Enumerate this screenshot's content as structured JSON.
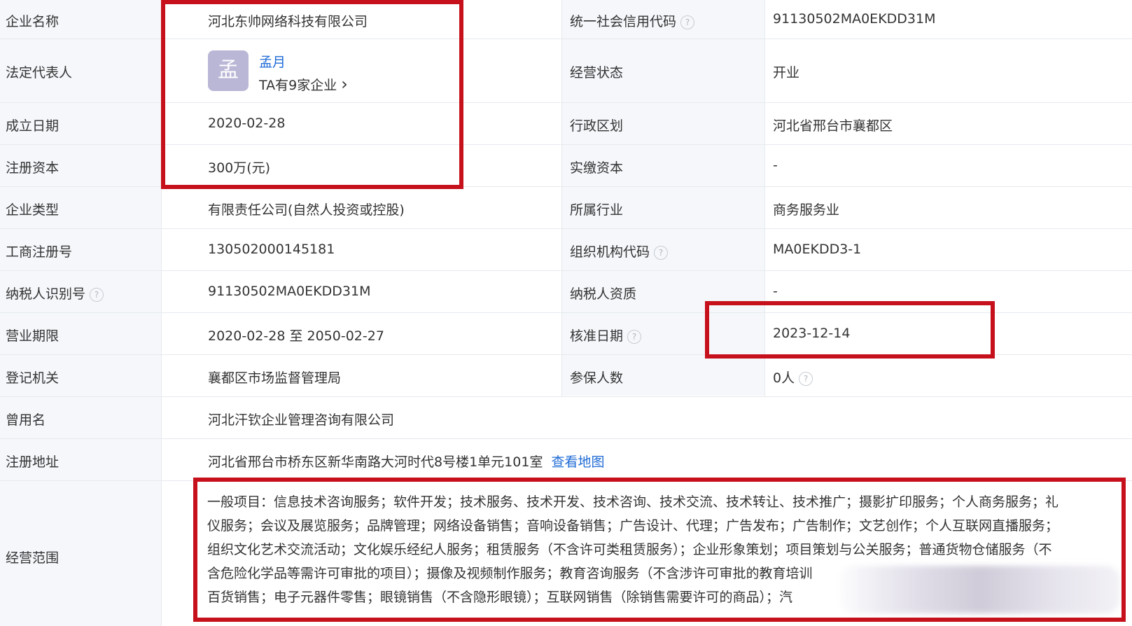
{
  "rows": {
    "company_name": {
      "label": "企业名称",
      "value": "河北东帅网络科技有限公司"
    },
    "credit_code": {
      "label": "统一社会信用代码",
      "value": "91130502MA0EKDD31M"
    },
    "legal_rep": {
      "label": "法定代表人",
      "name": "孟月",
      "avatar_char": "孟",
      "company_count": "TA有9家企业"
    },
    "business_status": {
      "label": "经营状态",
      "value": "开业"
    },
    "founded": {
      "label": "成立日期",
      "value": "2020-02-28"
    },
    "admin_region": {
      "label": "行政区划",
      "value": "河北省邢台市襄都区"
    },
    "reg_capital": {
      "label": "注册资本",
      "value": "300万(元)"
    },
    "paid_capital": {
      "label": "实缴资本",
      "value": "-"
    },
    "company_type": {
      "label": "企业类型",
      "value": "有限责任公司(自然人投资或控股)"
    },
    "industry": {
      "label": "所属行业",
      "value": "商务服务业"
    },
    "biz_reg_no": {
      "label": "工商注册号",
      "value": "130502000145181"
    },
    "org_code": {
      "label": "组织机构代码",
      "value": "MA0EKDD3-1"
    },
    "taxpayer_id": {
      "label": "纳税人识别号",
      "value": "91130502MA0EKDD31M"
    },
    "taxpayer_qual": {
      "label": "纳税人资质",
      "value": "-"
    },
    "biz_term": {
      "label": "营业期限",
      "value": "2020-02-28 至 2050-02-27"
    },
    "approval_date": {
      "label": "核准日期",
      "value": "2023-12-14"
    },
    "reg_authority": {
      "label": "登记机关",
      "value": "襄都区市场监督管理局"
    },
    "insured": {
      "label": "参保人数",
      "value": "0人"
    },
    "former_name": {
      "label": "曾用名",
      "value": "河北汗钦企业管理咨询有限公司"
    },
    "reg_address": {
      "label": "注册地址",
      "value": "河北省邢台市桥东区新华南路大河时代8号楼1单元101室",
      "map_link": "查看地图"
    },
    "biz_scope": {
      "label": "经营范围",
      "lines": [
        "一般项目：信息技术咨询服务；软件开发；技术服务、技术开发、技术咨询、技术交流、技术转让、技术推广；摄影扩印服务；个人商务服务；礼",
        "仪服务；会议及展览服务；品牌管理；网络设备销售；音响设备销售；广告设计、代理；广告发布；广告制作；文艺创作；个人互联网直播服务；",
        "组织文化艺术交流活动；文化娱乐经纪人服务；租赁服务（不含许可类租赁服务）；企业形象策划；项目策划与公关服务；普通货物仓储服务（不",
        "含危险化学品等需许可审批的项目）；摄像及视频制作服务；教育咨询服务（不含涉许可审批的教育培训",
        "百货销售；电子元器件零售；眼镜销售（不含隐形眼镜）；互联网销售（除销售需要许可的商品）；汽"
      ]
    }
  },
  "icons": {
    "help": "?",
    "chevron": "›"
  },
  "colors": {
    "highlight_red": "#c6111c",
    "link_blue": "#1f6bd6",
    "label_bg": "#f5f7fa"
  }
}
